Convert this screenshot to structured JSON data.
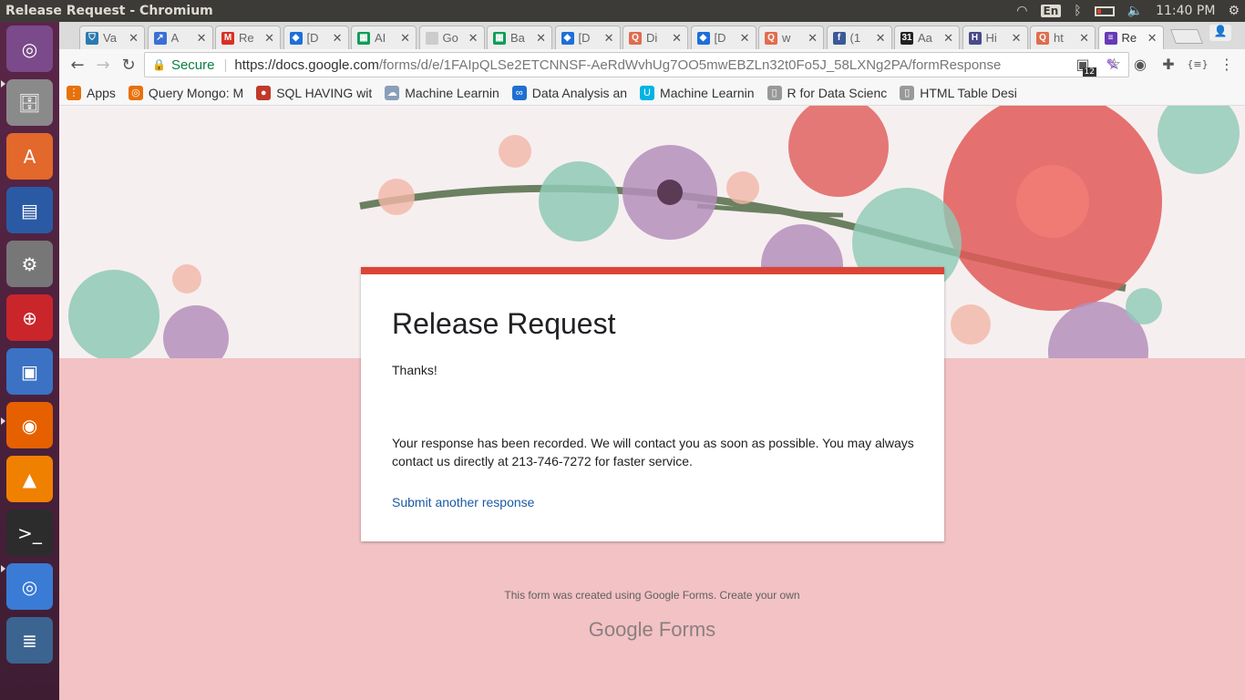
{
  "window_title": "Release Request - Chromium",
  "panel": {
    "lang": "En",
    "time": "11:40 PM"
  },
  "tabs": [
    {
      "label": "Va",
      "color": "#2a7ab0",
      "glyph": "⛉"
    },
    {
      "label": "A",
      "color": "#3b6fd6",
      "glyph": "↗"
    },
    {
      "label": "Re",
      "color": "#d93025",
      "glyph": "M"
    },
    {
      "label": "[D",
      "color": "#1e6fd9",
      "glyph": "◆"
    },
    {
      "label": "AI",
      "color": "#0f9d58",
      "glyph": "▦"
    },
    {
      "label": "Go",
      "color": "#cccccc",
      "glyph": ""
    },
    {
      "label": "Ba",
      "color": "#0f9d58",
      "glyph": "▦"
    },
    {
      "label": "[D",
      "color": "#1e6fd9",
      "glyph": "◆"
    },
    {
      "label": "Di",
      "color": "#e06d4f",
      "glyph": "Q"
    },
    {
      "label": "[D",
      "color": "#1e6fd9",
      "glyph": "◆"
    },
    {
      "label": "w",
      "color": "#e06d4f",
      "glyph": "Q"
    },
    {
      "label": "(1",
      "color": "#3b5998",
      "glyph": "f"
    },
    {
      "label": "Aa",
      "color": "#222222",
      "glyph": "31"
    },
    {
      "label": "Hi",
      "color": "#4a4a8a",
      "glyph": "H"
    },
    {
      "label": "ht",
      "color": "#e06d4f",
      "glyph": "Q"
    },
    {
      "label": "Re",
      "color": "#673ab7",
      "glyph": "≡"
    }
  ],
  "omnibox": {
    "secure_label": "Secure",
    "url_scheme_host": "https://docs.google.com",
    "url_path": "/forms/d/e/1FAIpQLSe2ETCNNSF-AeRdWvhUg7OO5mwEBZLn32t0Fo5J_58LXNg2PA/formResponse"
  },
  "extensions": {
    "badge": "12"
  },
  "bookmarks": [
    {
      "label": "Apps",
      "color": "#e8710a",
      "glyph": "⋮"
    },
    {
      "label": "Query Mongo: M",
      "color": "#e8710a",
      "glyph": "◎"
    },
    {
      "label": "SQL HAVING wit",
      "color": "#c0392b",
      "glyph": "●"
    },
    {
      "label": "Machine Learnin",
      "color": "#8aa0b8",
      "glyph": "☁"
    },
    {
      "label": "Data Analysis an",
      "color": "#1f6fd1",
      "glyph": "∞"
    },
    {
      "label": "Machine Learnin",
      "color": "#02b3e4",
      "glyph": "U"
    },
    {
      "label": "R for Data Scienc",
      "color": "#999999",
      "glyph": "▯"
    },
    {
      "label": "HTML Table Desi",
      "color": "#999999",
      "glyph": "▯"
    }
  ],
  "form": {
    "title": "Release Request",
    "thanks": "Thanks!",
    "message": "Your response has been recorded. We will contact you as soon as possible. You may always contact us directly at 213-746-7272 for faster service.",
    "submit_another": "Submit another response",
    "footer": "This form was created using Google Forms. Create your own",
    "logo": "Google Forms",
    "accent_color": "#db4437"
  },
  "launcher": [
    {
      "name": "ubuntu-dash-icon",
      "color": "#7b4a8a",
      "glyph": "◎"
    },
    {
      "name": "files-icon",
      "color": "#8a8a8a",
      "glyph": "🗄"
    },
    {
      "name": "software-center-icon",
      "color": "#e2682b",
      "glyph": "A"
    },
    {
      "name": "writer-icon",
      "color": "#2b5aa5",
      "glyph": "▤"
    },
    {
      "name": "system-settings-icon",
      "color": "#777777",
      "glyph": "⚙"
    },
    {
      "name": "ssl-vpn-icon",
      "color": "#c9252b",
      "glyph": "⊕"
    },
    {
      "name": "virtualbox-icon",
      "color": "#3b72c4",
      "glyph": "▣"
    },
    {
      "name": "firefox-icon",
      "color": "#e66000",
      "glyph": "◉"
    },
    {
      "name": "vlc-icon",
      "color": "#f08000",
      "glyph": "▲"
    },
    {
      "name": "terminal-icon",
      "color": "#2c2c2c",
      "glyph": ">_"
    },
    {
      "name": "chromium-icon",
      "color": "#3a7bd5",
      "glyph": "◎"
    },
    {
      "name": "workspace-stack-icon",
      "color": "#3b6490",
      "glyph": "≣"
    }
  ]
}
